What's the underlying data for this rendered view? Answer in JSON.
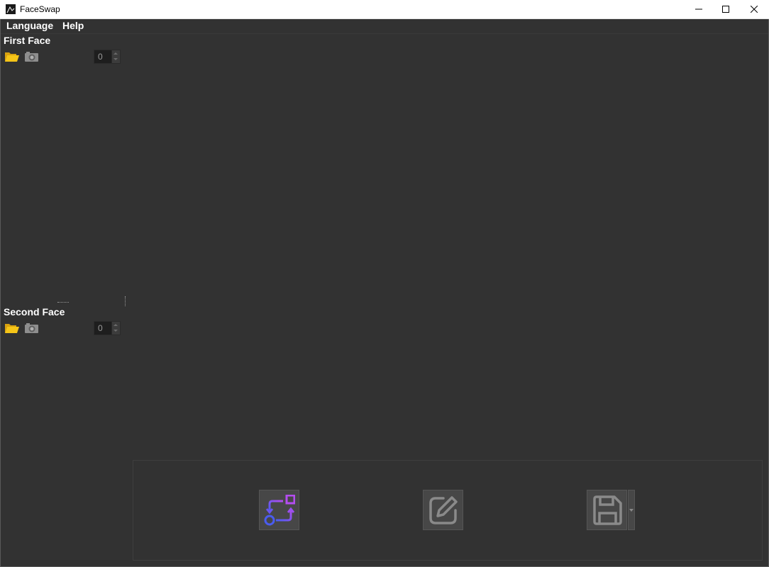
{
  "window": {
    "title": "FaceSwap"
  },
  "menu": {
    "items": [
      "Language",
      "Help"
    ]
  },
  "first_face": {
    "title": "First Face",
    "spin_value": "0"
  },
  "second_face": {
    "title": "Second Face",
    "spin_value": "0"
  },
  "icons": {
    "folder": "open-folder-icon",
    "camera": "camera-icon",
    "swap": "swap-faces-icon",
    "edit": "edit-icon",
    "save": "save-icon"
  },
  "colors": {
    "background": "#323232",
    "folder": "#f5c518",
    "swap_blue": "#4a5cf0",
    "swap_purple": "#b44df0"
  }
}
